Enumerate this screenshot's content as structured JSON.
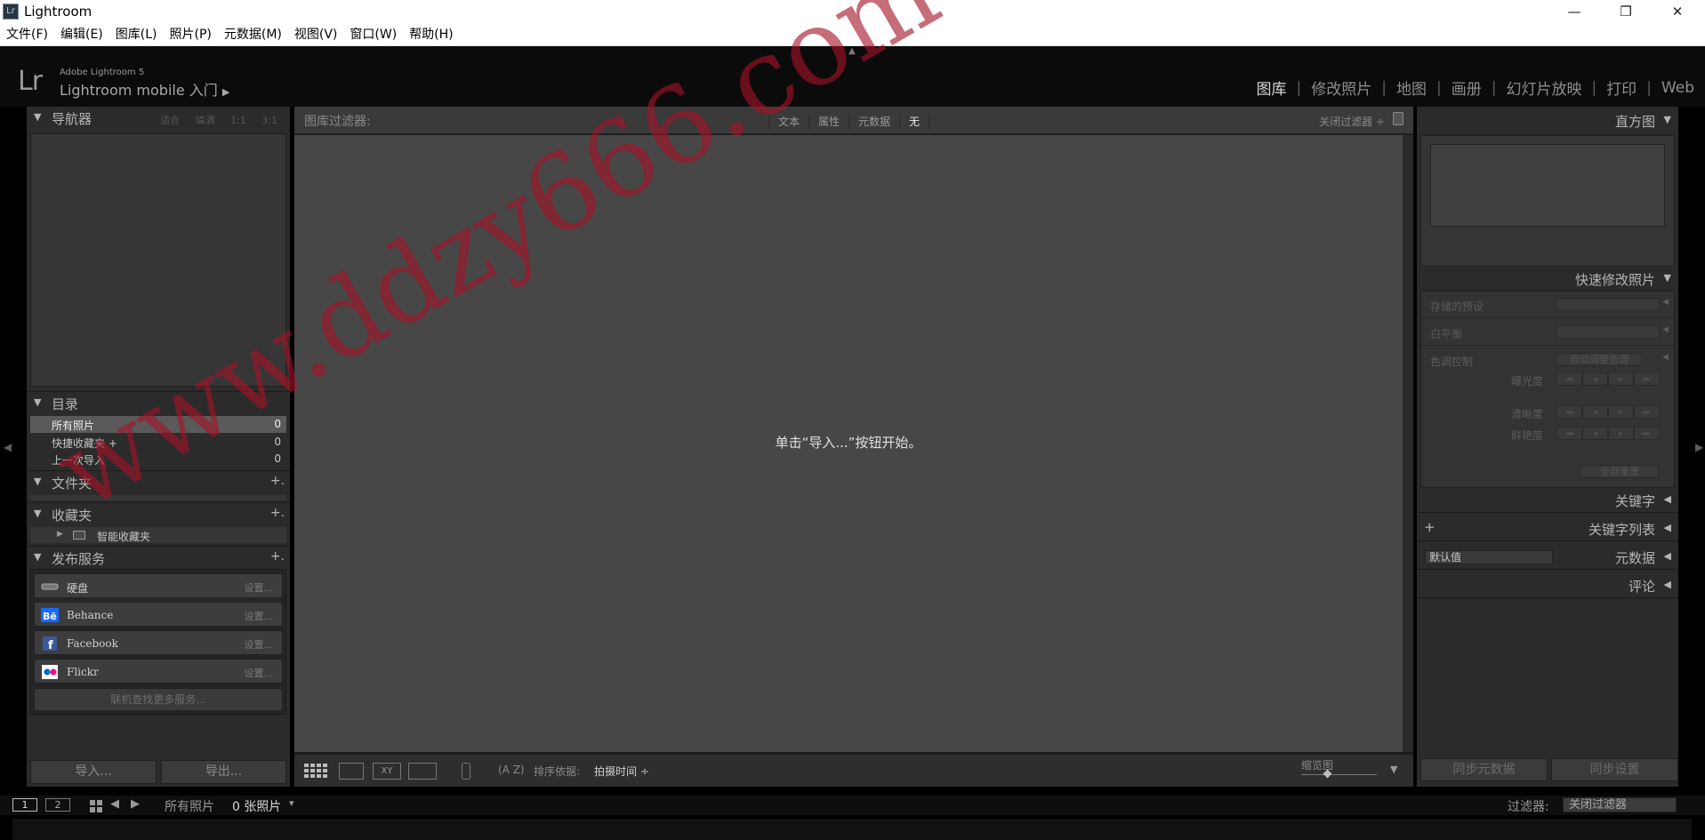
{
  "window": {
    "app_icon": "Lr",
    "title": "Lightroom",
    "minimize": "—",
    "maximize": "❐",
    "close": "✕"
  },
  "menu": [
    "文件(F)",
    "编辑(E)",
    "图库(L)",
    "照片(P)",
    "元数据(M)",
    "视图(V)",
    "窗口(W)",
    "帮助(H)"
  ],
  "header": {
    "logo": "Lr",
    "product": "Adobe Lightroom 5",
    "identity": "Lightroom mobile 入门",
    "identity_arrow": "▶",
    "top_arrow": "▲",
    "modules": [
      "图库",
      "修改照片",
      "地图",
      "画册",
      "幻灯片放映",
      "打印",
      "Web"
    ],
    "active_module": "图库"
  },
  "left_panel": {
    "navigator": {
      "label": "导航器",
      "options": [
        "适合",
        "填满",
        "1:1",
        "3:1"
      ]
    },
    "catalog": {
      "label": "目录",
      "items": [
        {
          "name": "所有照片",
          "count": "0",
          "selected": true
        },
        {
          "name": "快捷收藏夹 +",
          "count": "0"
        },
        {
          "name": "上一次导入",
          "count": "0"
        }
      ]
    },
    "folders": {
      "label": "文件夹",
      "plus": "+."
    },
    "collections": {
      "label": "收藏夹",
      "plus": "+.",
      "item": "智能收藏夹"
    },
    "publish": {
      "label": "发布服务",
      "plus": "+.",
      "services": [
        {
          "name": "硬盘",
          "setup": "设置...",
          "icon": "hard-drive-icon"
        },
        {
          "name": "Behance",
          "setup": "设置...",
          "icon": "behance-icon"
        },
        {
          "name": "Facebook",
          "setup": "设置...",
          "icon": "facebook-icon"
        },
        {
          "name": "Flickr",
          "setup": "设置...",
          "icon": "flickr-icon"
        }
      ],
      "more": "联机查找更多服务..."
    },
    "import_button": "导入...",
    "export_button": "导出..."
  },
  "center": {
    "filter_title": "图库过滤器:",
    "filter_tabs": [
      "文本",
      "属性",
      "元数据",
      "无"
    ],
    "active_filter": "无",
    "close_filter": "关闭过滤器 ÷",
    "message": "单击“导入...”按钮开始。",
    "toolbar": {
      "sort_label": "排序依据:",
      "sort_value": "拍摄时间 ÷",
      "thumbnail_label": "缩览图",
      "thumbnail_level": 0.35,
      "menu_arrow": "▼"
    }
  },
  "right_panel": {
    "histogram": "直方图",
    "quick_develop": {
      "label": "快速修改照片",
      "saved_preset": "存储的预设",
      "white_balance": "白平衡",
      "tone_control": "色调控制",
      "auto_tone": "自动调整色调",
      "exposure": "曝光度",
      "clarity": "清晰度",
      "vibrance": "鲜艳度",
      "reset_all": "全部重置",
      "step_buttons": [
        "◂◂",
        "◂",
        "▸",
        "▸▸"
      ]
    },
    "keywording": "关键字",
    "keyword_list": "关键字列表",
    "metadata": "元数据",
    "metadata_preset": "默认值",
    "comments": "评论",
    "sync_metadata": "同步元数据",
    "sync_settings": "同步设置"
  },
  "filmstrip": {
    "page1": "1",
    "page2": "2",
    "source": "所有照片",
    "count": "0 张照片",
    "dropdown": "▾",
    "filter_label": "过滤器:",
    "filter_value": "关闭过滤器"
  },
  "watermark": "www.ddzy666.com",
  "colors": {
    "panel_bg": "#2b2b2b",
    "grid_bg": "#474747",
    "header_bg": "#0b0b0b",
    "watermark": "#a51226"
  }
}
